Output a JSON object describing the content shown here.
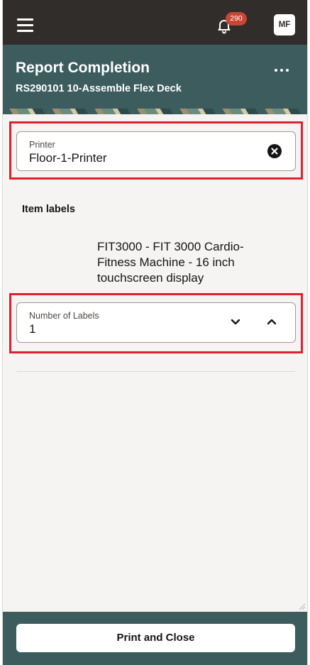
{
  "topbar": {
    "menu_icon": "hamburger-menu-icon",
    "notifications": {
      "icon": "bell-icon",
      "count": "290"
    },
    "user_initials": "MF"
  },
  "header": {
    "title": "Report Completion",
    "subtitle": "RS290101 10-Assemble Flex Deck",
    "more_icon": "more-options-icon"
  },
  "printer_field": {
    "label": "Printer",
    "value": "Floor-1-Printer",
    "clear_icon": "clear-circle-icon"
  },
  "item_labels": {
    "section_title": "Item labels",
    "item_description": "FIT3000 - FIT 3000 Cardio-Fitness Machine - 16 inch touchscreen display",
    "number_of_labels": {
      "label": "Number of Labels",
      "value": "1",
      "decrement_icon": "chevron-down-icon",
      "increment_icon": "chevron-up-icon"
    }
  },
  "footer": {
    "print_button_label": "Print and Close"
  },
  "colors": {
    "topbar_bg": "#312d2a",
    "header_bg": "#3d5c5e",
    "page_bg": "#f6f4f2",
    "badge_bg": "#c74634",
    "highlight_border": "#e0202e"
  }
}
